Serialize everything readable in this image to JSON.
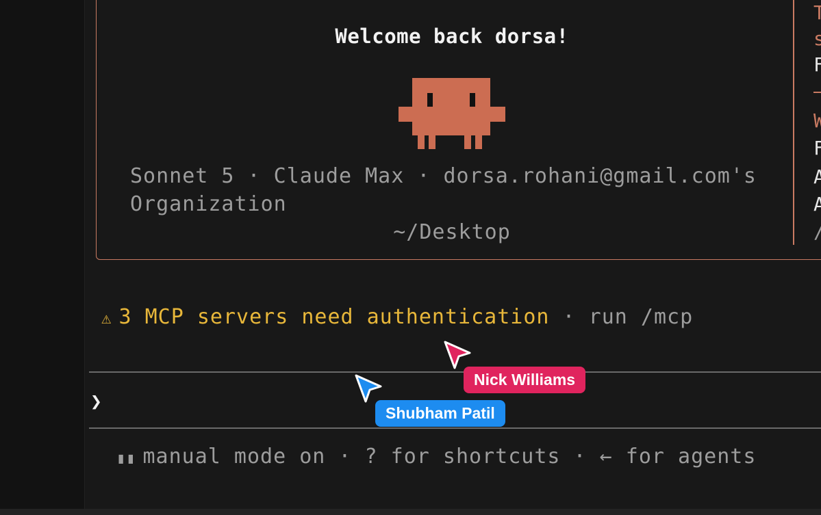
{
  "welcome": {
    "title": "Welcome back dorsa!",
    "info_line_1": "Sonnet 5 · Claude Max · dorsa.rohani@gmail.com's",
    "info_line_2": "Organization",
    "cwd": "~/Desktop"
  },
  "side_panel_chars": [
    {
      "text": "T",
      "color": "#c97a62"
    },
    {
      "text": "s",
      "color": "#c97a62"
    },
    {
      "text": "F",
      "color": "#e6e6e6"
    },
    {
      "text": "W",
      "color": "#c97a62"
    },
    {
      "text": "F",
      "color": "#e6e6e6"
    },
    {
      "text": "A",
      "color": "#e6e6e6"
    },
    {
      "text": "A",
      "color": "#e6e6e6"
    },
    {
      "text": "/",
      "color": "#9d9d9d"
    }
  ],
  "warning": {
    "icon": "warning-icon",
    "text": "3 MCP servers need authentication",
    "hint": " · run /mcp"
  },
  "prompt": {
    "caret": "❯"
  },
  "status": {
    "icon": "pause-icon",
    "text": "manual mode on · ? for shortcuts · ← for agents"
  },
  "collaborators": [
    {
      "name": "Nick Williams",
      "color": "#e0245e"
    },
    {
      "name": "Shubham Patil",
      "color": "#1d8cf0"
    }
  ],
  "colors": {
    "accent": "#c97a62",
    "warning": "#e8b73a",
    "muted_text": "#9d9d9d",
    "background": "#181818"
  }
}
